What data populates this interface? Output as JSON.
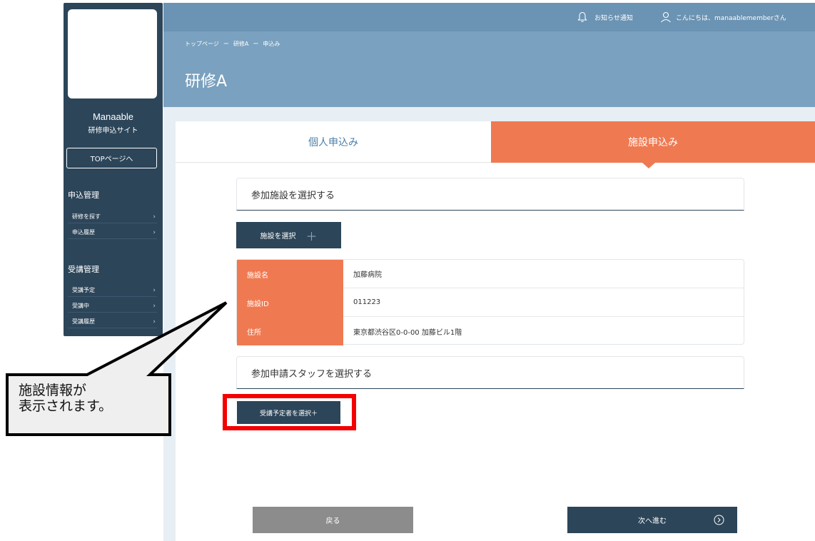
{
  "sidebar": {
    "brand_name": "Manaable",
    "brand_sub": "研修申込サイト",
    "top_button": "TOPページへ",
    "sections": [
      {
        "title": "申込管理",
        "items": [
          "研修を探す",
          "申込履歴"
        ]
      },
      {
        "title": "受講管理",
        "items": [
          "受講予定",
          "受講中",
          "受講履歴"
        ]
      }
    ]
  },
  "header": {
    "notification": "お知らせ通知",
    "greeting": "こんにちは、manaablememberさん",
    "breadcrumb": [
      "トップページ",
      "ー",
      "研修A",
      "ー",
      "申込み"
    ],
    "title": "研修A"
  },
  "tabs": {
    "personal": "個人申込み",
    "facility": "施設申込み"
  },
  "facility_section": {
    "title": "参加施設を選択する",
    "select_button": "施設を選択",
    "plus": "＋",
    "rows": [
      {
        "key": "施設名",
        "value": "加藤病院"
      },
      {
        "key": "施設ID",
        "value": "011223"
      },
      {
        "key": "住所",
        "value": "東京都渋谷区0-0-00 加藤ビル1階"
      }
    ]
  },
  "staff_section": {
    "title": "参加申請スタッフを選択する",
    "select_button": "受講予定者を選択＋"
  },
  "footer": {
    "back": "戻る",
    "next": "次へ進む"
  },
  "callout": {
    "line1": "施設情報が",
    "line2": "表示されます。"
  },
  "colors": {
    "navy": "#2c4559",
    "orange": "#ef7a52",
    "header_blue": "#7aa1bf",
    "highlight_red": "#f40000"
  }
}
